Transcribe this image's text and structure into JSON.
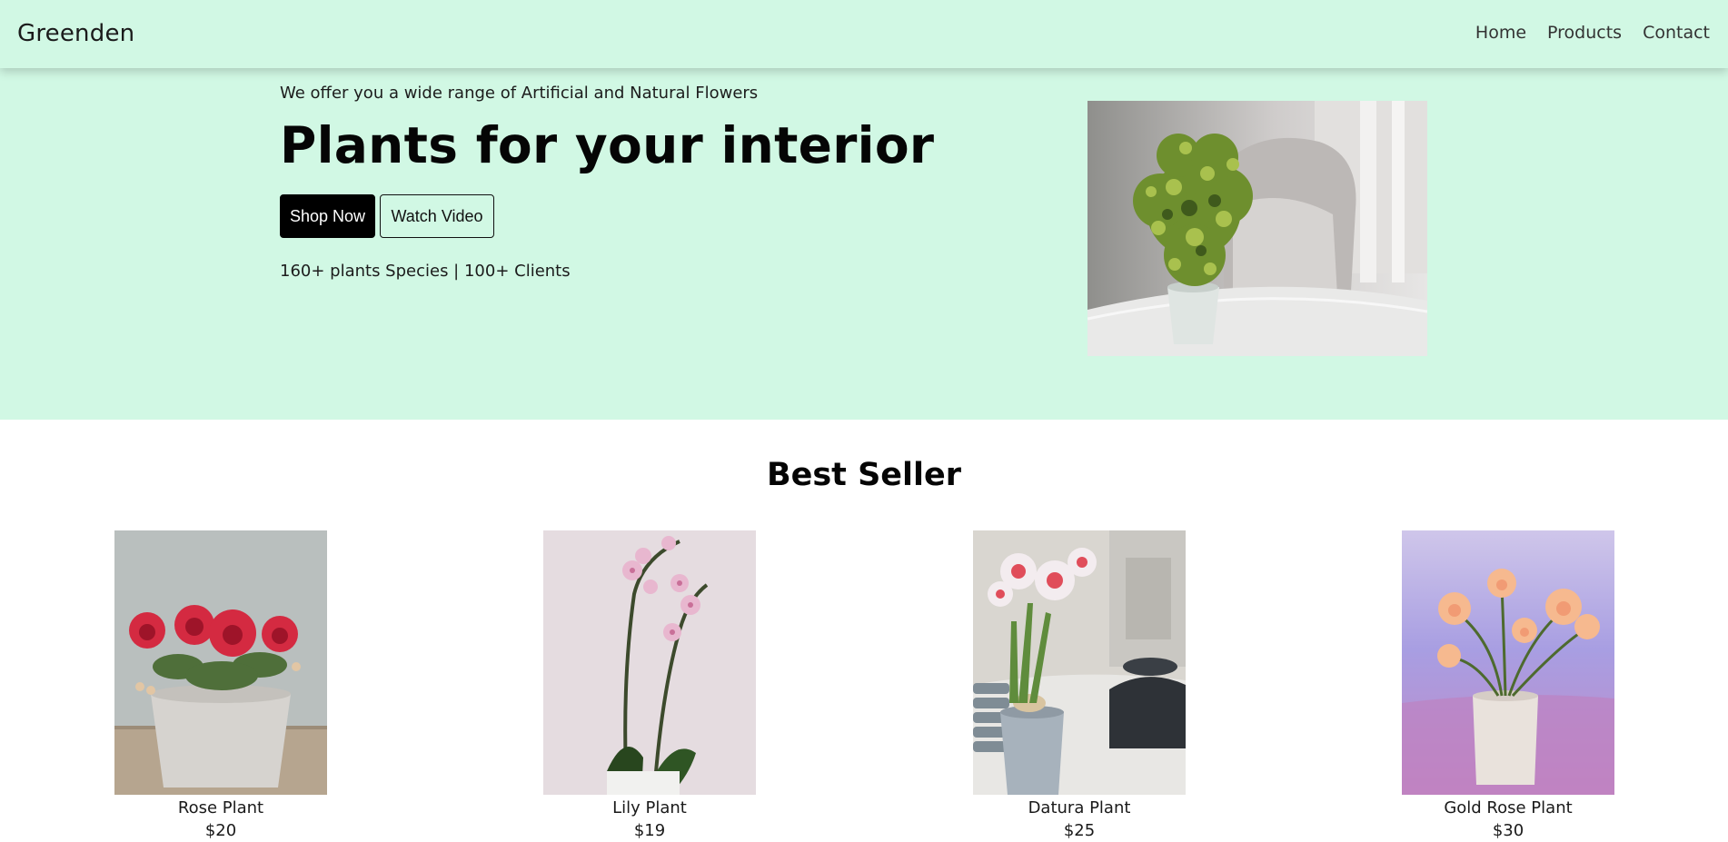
{
  "navbar": {
    "brand": "Greenden",
    "links": [
      "Home",
      "Products",
      "Contact"
    ]
  },
  "hero": {
    "tagline": "We offer you a wide range of Artificial and Natural Flowers",
    "headline": "Plants for your interior",
    "shop_button": "Shop Now",
    "video_button": "Watch Video",
    "stats": "160+ plants Species | 100+ Clients",
    "background_color": "#d1f8e4"
  },
  "best_seller": {
    "title": "Best Seller",
    "products": [
      {
        "name": "Rose Plant",
        "price": "$20"
      },
      {
        "name": "Lily Plant",
        "price": "$19"
      },
      {
        "name": "Datura Plant",
        "price": "$25"
      },
      {
        "name": "Gold Rose Plant",
        "price": "$30"
      }
    ]
  },
  "colors": {
    "accent": "#d1f8e4",
    "primary_button": "#000000"
  }
}
